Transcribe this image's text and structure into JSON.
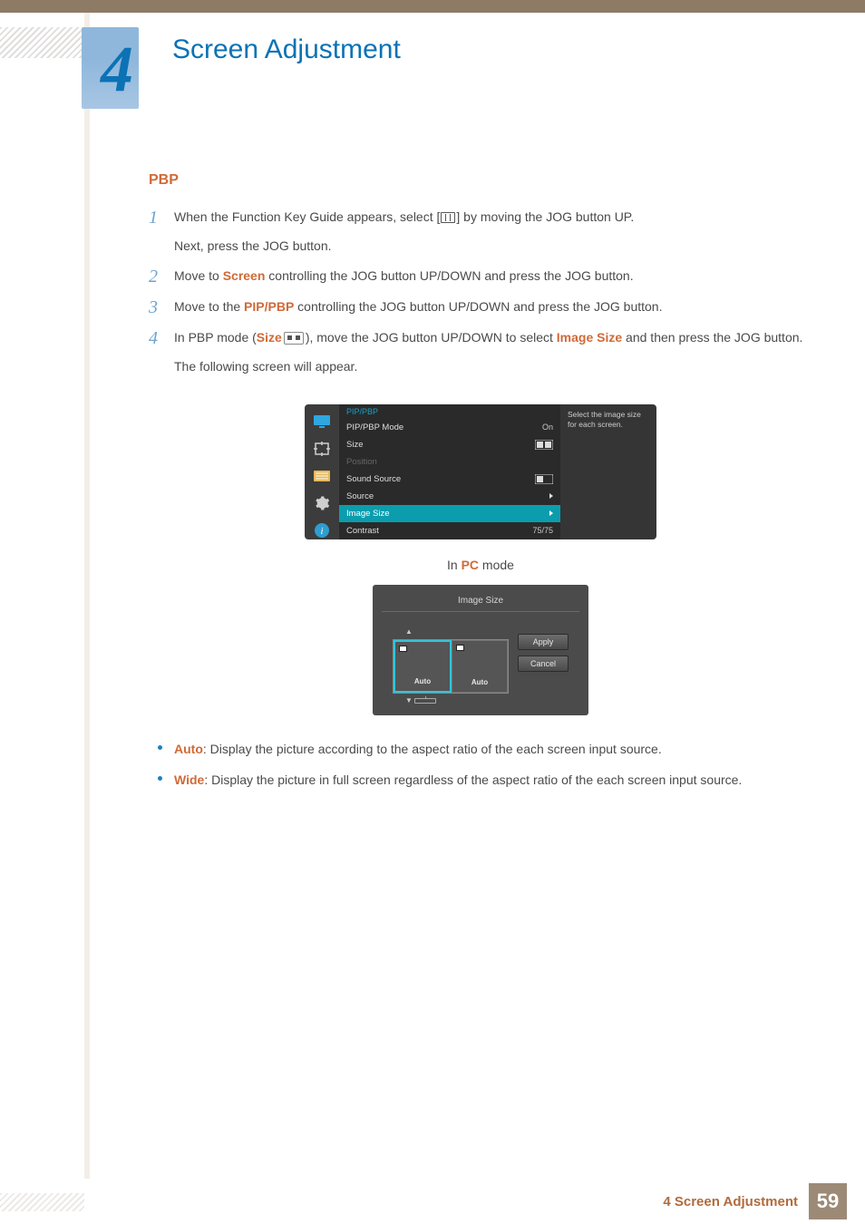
{
  "chapter": {
    "number": "4",
    "title": "Screen Adjustment"
  },
  "section": {
    "heading": "PBP"
  },
  "steps": [
    {
      "num": "1",
      "pre": "When the Function Key Guide appears, select [",
      "post": "] by moving the JOG button UP.",
      "sub": "Next, press the JOG button."
    },
    {
      "num": "2",
      "pre": "Move to ",
      "kw1": "Screen",
      "post": " controlling the JOG button UP/DOWN and press the JOG button."
    },
    {
      "num": "3",
      "pre": "Move to the ",
      "kw1": "PIP/PBP",
      "post": " controlling the JOG button UP/DOWN and press the JOG button."
    },
    {
      "num": "4",
      "pre": "In PBP mode (",
      "kw1": "Size",
      "mid": " ",
      "post2": "), move the JOG button UP/DOWN to select ",
      "kw2": "Image Size",
      "post3": " and then press the JOG button.",
      "sub": "The following screen will appear."
    }
  ],
  "osd": {
    "title": "PIP/PBP",
    "desc": "Select the image size for each screen.",
    "rows": [
      {
        "label": "PIP/PBP Mode",
        "value": "On"
      },
      {
        "label": "Size",
        "value_icon": "dual"
      },
      {
        "label": "Position",
        "disabled": true
      },
      {
        "label": "Sound Source",
        "value_icon": "single-left"
      },
      {
        "label": "Source",
        "value_icon": "arrow"
      },
      {
        "label": "Image Size",
        "value_icon": "arrow",
        "selected": true
      },
      {
        "label": "Contrast",
        "value": "75/75"
      }
    ]
  },
  "caption": {
    "pre": "In ",
    "kw": "PC",
    "post": " mode"
  },
  "selector": {
    "title": "Image Size",
    "left_label": "Auto",
    "right_label": "Auto",
    "apply": "Apply",
    "cancel": "Cancel"
  },
  "bullets": [
    {
      "kw": "Auto",
      "text": ": Display the picture according to the aspect ratio of the each screen input source."
    },
    {
      "kw": "Wide",
      "text": ": Display the picture in full screen regardless of the aspect ratio of the each screen input source."
    }
  ],
  "footer": {
    "text": "4 Screen Adjustment",
    "page": "59"
  }
}
